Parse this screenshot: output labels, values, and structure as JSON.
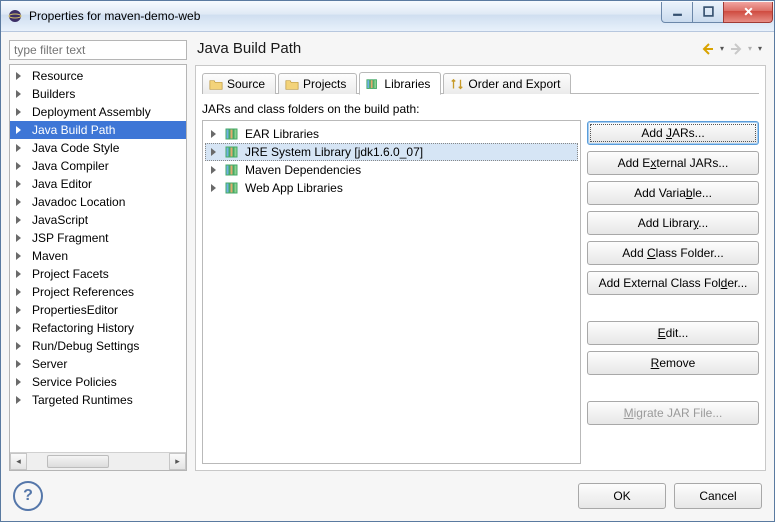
{
  "window": {
    "title": "Properties for maven-demo-web"
  },
  "sidebar": {
    "filter_placeholder": "type filter text",
    "items": [
      "Resource",
      "Builders",
      "Deployment Assembly",
      "Java Build Path",
      "Java Code Style",
      "Java Compiler",
      "Java Editor",
      "Javadoc Location",
      "JavaScript",
      "JSP Fragment",
      "Maven",
      "Project Facets",
      "Project References",
      "PropertiesEditor",
      "Refactoring History",
      "Run/Debug Settings",
      "Server",
      "Service Policies",
      "Targeted Runtimes"
    ],
    "selected_index": 3
  },
  "page": {
    "title": "Java Build Path",
    "tabs": [
      {
        "label": "Source"
      },
      {
        "label": "Projects"
      },
      {
        "label": "Libraries"
      },
      {
        "label": "Order and Export"
      }
    ],
    "active_tab": 2,
    "description": "JARs and class folders on the build path:",
    "libraries": [
      "EAR Libraries",
      "JRE System Library [jdk1.6.0_07]",
      "Maven Dependencies",
      "Web App Libraries"
    ],
    "selected_library": 1,
    "buttons": {
      "add_jars": "Add JARs...",
      "add_external_jars": "Add External JARs...",
      "add_variable": "Add Variable...",
      "add_library": "Add Library...",
      "add_class_folder": "Add Class Folder...",
      "add_external_class_folder": "Add External Class Folder...",
      "edit": "Edit...",
      "remove": "Remove",
      "migrate": "Migrate JAR File..."
    }
  },
  "footer": {
    "ok": "OK",
    "cancel": "Cancel"
  }
}
